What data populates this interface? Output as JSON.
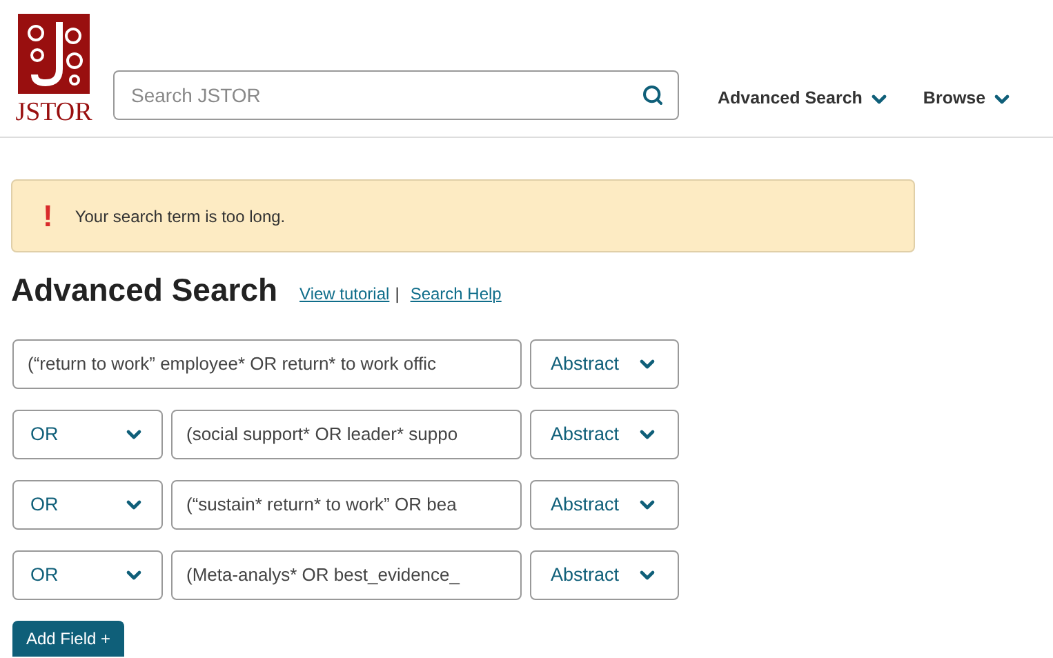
{
  "header": {
    "logo_text": "JSTOR",
    "search": {
      "placeholder": "Search JSTOR"
    },
    "nav": [
      {
        "label": "Advanced Search"
      },
      {
        "label": "Browse"
      }
    ]
  },
  "alert": {
    "icon": "!",
    "message": "Your search term is too long."
  },
  "page_title": "Advanced Search",
  "help_links": [
    {
      "label": "View tutorial"
    },
    {
      "label": "Search Help"
    }
  ],
  "help_separator": "|",
  "rows": [
    {
      "query": "(“return to work” employee* OR return* to work offic",
      "field": "Abstract"
    },
    {
      "operator": "OR",
      "query": "(social support* OR leader* suppo",
      "field": "Abstract"
    },
    {
      "operator": "OR",
      "query": "(“sustain* return* to work” OR bea",
      "field": "Abstract"
    },
    {
      "operator": "OR",
      "query": "(Meta-analys* OR best_evidence_",
      "field": "Abstract"
    }
  ],
  "add_button": "Add Field +"
}
